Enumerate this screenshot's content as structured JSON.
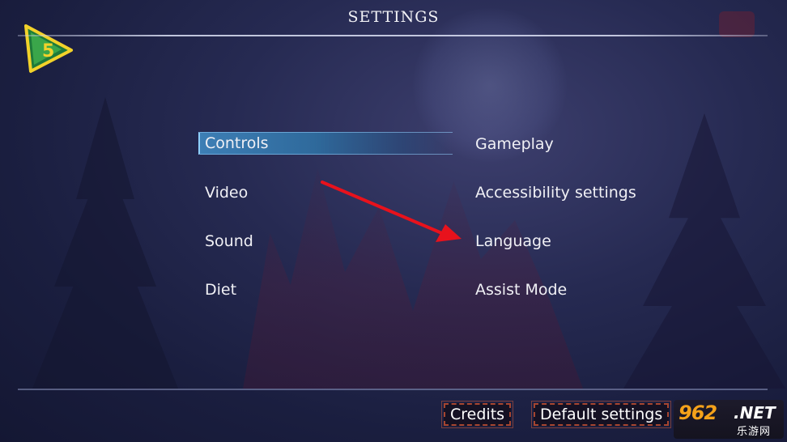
{
  "screen": {
    "title": "SETTINGS"
  },
  "logo": {
    "badge_number": "5",
    "icon": "triangle-5-logo-icon"
  },
  "menu": {
    "left": [
      {
        "label": "Controls",
        "selected": true
      },
      {
        "label": "Video",
        "selected": false
      },
      {
        "label": "Sound",
        "selected": false
      },
      {
        "label": "Diet",
        "selected": false
      }
    ],
    "right": [
      {
        "label": "Gameplay",
        "selected": false
      },
      {
        "label": "Accessibility settings",
        "selected": false
      },
      {
        "label": "Language",
        "selected": false
      },
      {
        "label": "Assist Mode",
        "selected": false
      }
    ]
  },
  "annotation": {
    "icon": "red-arrow-icon",
    "color": "#e8121c",
    "points_to": "Language"
  },
  "footer": {
    "credits_label": "Credits",
    "default_settings_label": "Default settings"
  },
  "watermark": {
    "number": "962",
    "suffix": ".NET",
    "chinese": "乐游网"
  },
  "colors": {
    "selection_blue": "#3d7eb5",
    "button_border": "#a6452f",
    "logo_green": "#3aa64a",
    "logo_yellow": "#f2d22a"
  }
}
